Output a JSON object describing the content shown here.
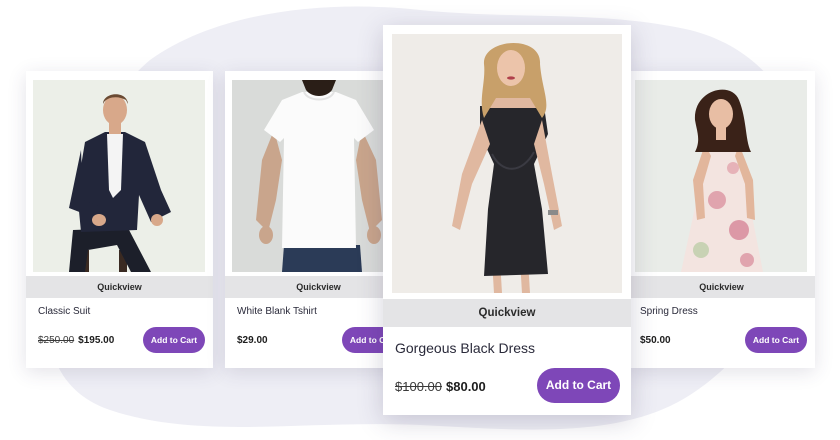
{
  "products": [
    {
      "name": "Classic Suit",
      "old_price": "$250.00",
      "price": "$195.00",
      "quickview": "Quickview",
      "cta": "Add to Cart"
    },
    {
      "name": "White Blank Tshirt",
      "old_price": "",
      "price": "$29.00",
      "quickview": "Quickview",
      "cta": "Add to Cart"
    },
    {
      "name": "Gorgeous Black Dress",
      "old_price": "$100.00",
      "price": "$80.00",
      "quickview": "Quickview",
      "cta": "Add to Cart"
    },
    {
      "name": "Spring Dress",
      "old_price": "",
      "price": "$50.00",
      "quickview": "Quickview",
      "cta": "Add to Cart"
    }
  ],
  "colors": {
    "accent": "#7e47b8",
    "quickview_bg": "#e4e4e6",
    "blob": "#eeeef5"
  }
}
